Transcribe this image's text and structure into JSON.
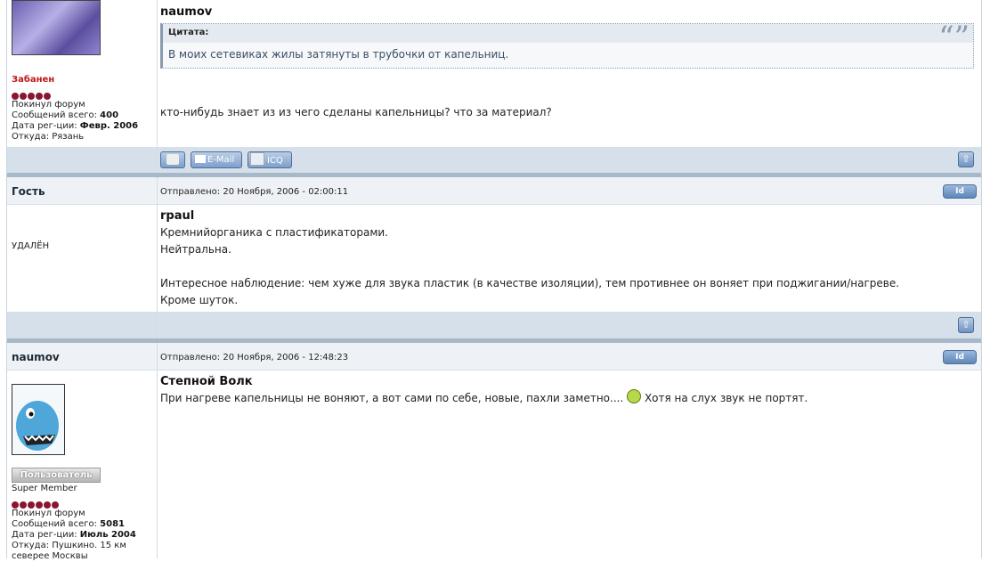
{
  "post1": {
    "avatar_alt": "",
    "status": "Забанен",
    "rank_dots": 5,
    "info": [
      {
        "label": "Покинул форум",
        "value": ""
      },
      {
        "label": "Сообщений всего:",
        "value": "400"
      },
      {
        "label": "Дата рег-ции:",
        "value": "Февр. 2006"
      },
      {
        "label": "Откуда:",
        "value": "Рязань"
      }
    ],
    "quote_author": "naumov",
    "quote_title": "Цитата:",
    "quote_text": "В моих сетевиках жилы затянуты в трубочки от капельниц.",
    "text": "кто-нибудь знает из из чего сделаны капельницы? что за материал?",
    "buttons": {
      "email": "E-Mail",
      "icq": "ICQ"
    }
  },
  "post2": {
    "nick": "Гость",
    "sent": "Отправлено: 20 Ноября, 2006 - 02:00:11",
    "id_label": "Id",
    "side_text": "УДАЛЁН",
    "author": "rpaul",
    "lines": [
      "Кремнийорганика с пластификаторами.",
      "Нейтральна.",
      "",
      "Интересное наблюдение: чем хуже для звука пластик (в качестве изоляции), тем противнее он воняет при поджигании/нагреве.",
      "Кроме шуток."
    ]
  },
  "post3": {
    "nick": "naumov",
    "sent": "Отправлено: 20 Ноября, 2006 - 12:48:23",
    "id_label": "Id",
    "rank_badge": "Пользователь",
    "rank_title": "Super Member",
    "rank_dots": 6,
    "info": [
      {
        "label": "Покинул форум",
        "value": ""
      },
      {
        "label": "Сообщений всего:",
        "value": "5081"
      },
      {
        "label": "Дата рег-ции:",
        "value": "Июль 2004"
      },
      {
        "label": "Откуда:",
        "value": "Пушкино. 15 км северее Москвы"
      }
    ],
    "author": "Степной Волк",
    "text_before": "При нагреве капельницы не воняют, а вот сами по себе, новые, пахли заметно....",
    "text_after": "Хотя на слух звук не портят."
  },
  "colors": {
    "ban_red": "#c01818",
    "dots": "#8a1530",
    "accent": "#5f86b8"
  }
}
